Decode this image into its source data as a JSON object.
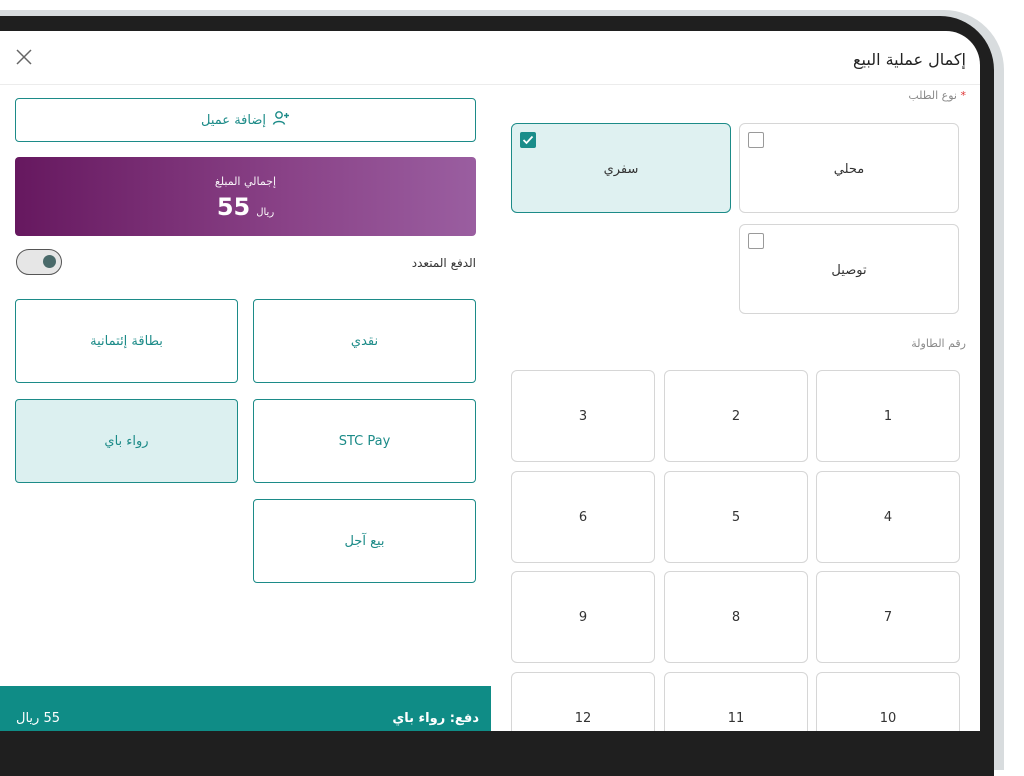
{
  "header": {
    "title": "إكمال عملية البيع"
  },
  "order_type": {
    "label": "نوع الطلب",
    "required_mark": "*",
    "options": [
      {
        "label": "محلي",
        "checked": false
      },
      {
        "label": "سفري",
        "checked": true
      },
      {
        "label": "توصيل",
        "checked": false
      }
    ]
  },
  "table_section": {
    "label": "رقم الطاولة",
    "tables": [
      "1",
      "2",
      "3",
      "4",
      "5",
      "6",
      "7",
      "8",
      "9",
      "10",
      "11",
      "12"
    ]
  },
  "customer": {
    "add_label": "إضافة عميل"
  },
  "total": {
    "label": "إجمالي المبلغ",
    "amount": "55",
    "currency": "ريال"
  },
  "multi_payment": {
    "label": "الدفع المتعدد",
    "enabled": false
  },
  "payment_methods": [
    {
      "label": "نقدي",
      "active": false
    },
    {
      "label": "بطاقة إئتمانية",
      "active": false
    },
    {
      "label": "STC Pay",
      "active": false
    },
    {
      "label": "رواء باي",
      "active": true
    },
    {
      "label": "بيع آجل",
      "active": false
    }
  ],
  "footer": {
    "pay_text": "دفع: رواء باي",
    "amount_text": "55 ريال"
  },
  "colors": {
    "accent": "#1c8b88",
    "total_bg_start": "#66185f",
    "total_bg_end": "#9a5ea0",
    "footer_bg": "#0f8c86"
  }
}
